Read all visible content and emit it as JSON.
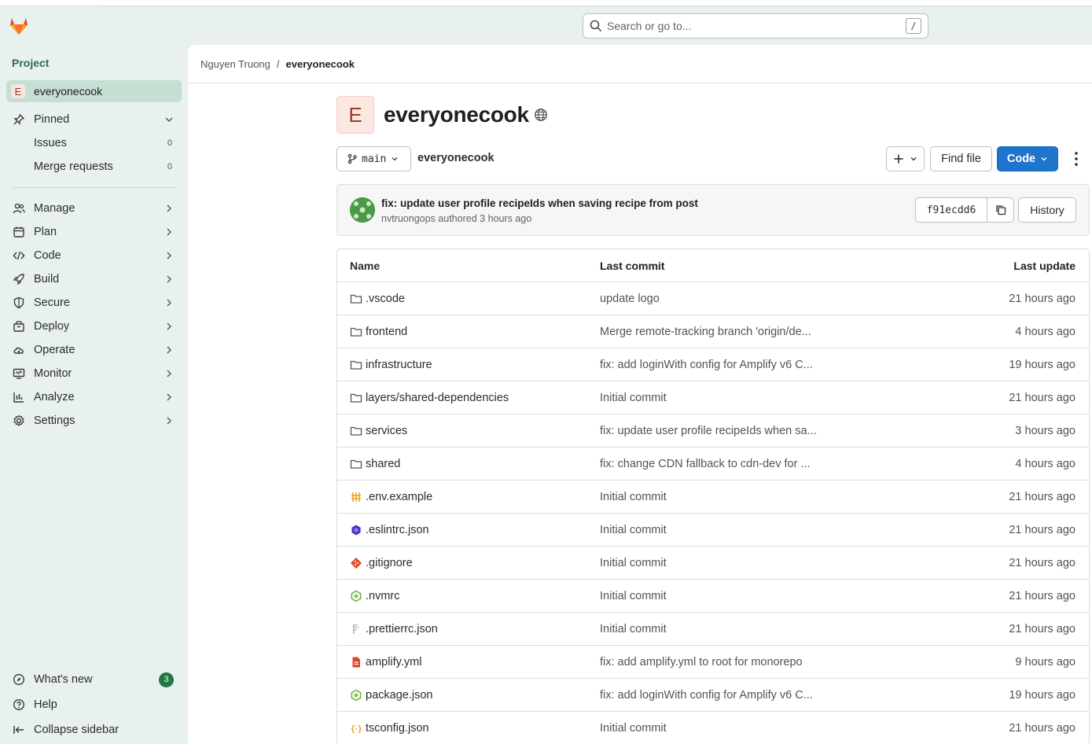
{
  "search": {
    "placeholder": "Search or go to...",
    "shortcut": "/"
  },
  "sidebar": {
    "section_label": "Project",
    "project": {
      "initial": "E",
      "name": "everyonecook"
    },
    "pinned": {
      "label": "Pinned",
      "items": [
        {
          "label": "Issues",
          "count": "0"
        },
        {
          "label": "Merge requests",
          "count": "0"
        }
      ]
    },
    "nav": [
      {
        "label": "Manage",
        "icon": "users-icon"
      },
      {
        "label": "Plan",
        "icon": "calendar-icon"
      },
      {
        "label": "Code",
        "icon": "code-icon"
      },
      {
        "label": "Build",
        "icon": "rocket-icon"
      },
      {
        "label": "Secure",
        "icon": "shield-icon"
      },
      {
        "label": "Deploy",
        "icon": "deploy-icon"
      },
      {
        "label": "Operate",
        "icon": "cloud-gear-icon"
      },
      {
        "label": "Monitor",
        "icon": "monitor-icon"
      },
      {
        "label": "Analyze",
        "icon": "chart-icon"
      },
      {
        "label": "Settings",
        "icon": "gear-icon"
      }
    ],
    "footer": {
      "whats_new": "What's new",
      "whats_new_count": "3",
      "help": "Help",
      "collapse": "Collapse sidebar"
    }
  },
  "breadcrumb": {
    "owner": "Nguyen Truong",
    "separator": "/",
    "project": "everyonecook"
  },
  "project_header": {
    "initial": "E",
    "title": "everyonecook"
  },
  "toolbar": {
    "branch": "main",
    "path": "everyonecook",
    "find_file": "Find file",
    "code": "Code"
  },
  "last_commit": {
    "message": "fix: update user profile recipeIds when saving recipe from post",
    "author": "nvtruongops",
    "authored_text": "authored",
    "time": "3 hours ago",
    "sha": "f91ecdd6",
    "history": "History"
  },
  "files": {
    "headers": {
      "name": "Name",
      "last_commit": "Last commit",
      "last_update": "Last update"
    },
    "rows": [
      {
        "name": ".vscode",
        "type": "folder",
        "commit": "update logo",
        "updated": "21 hours ago"
      },
      {
        "name": "frontend",
        "type": "folder",
        "commit": "Merge remote-tracking branch 'origin/de...",
        "updated": "4 hours ago"
      },
      {
        "name": "infrastructure",
        "type": "folder",
        "commit": "fix: add loginWith config for Amplify v6 C...",
        "updated": "19 hours ago"
      },
      {
        "name": "layers/shared-dependencies",
        "type": "folder",
        "commit": "Initial commit",
        "updated": "21 hours ago"
      },
      {
        "name": "services",
        "type": "folder",
        "commit": "fix: update user profile recipeIds when sa...",
        "updated": "3 hours ago"
      },
      {
        "name": "shared",
        "type": "folder",
        "commit": "fix: change CDN fallback to cdn-dev for ...",
        "updated": "4 hours ago"
      },
      {
        "name": ".env.example",
        "type": "env",
        "commit": "Initial commit",
        "updated": "21 hours ago"
      },
      {
        "name": ".eslintrc.json",
        "type": "eslint",
        "commit": "Initial commit",
        "updated": "21 hours ago"
      },
      {
        "name": ".gitignore",
        "type": "git",
        "commit": "Initial commit",
        "updated": "21 hours ago"
      },
      {
        "name": ".nvmrc",
        "type": "node",
        "commit": "Initial commit",
        "updated": "21 hours ago"
      },
      {
        "name": ".prettierrc.json",
        "type": "prettier",
        "commit": "Initial commit",
        "updated": "21 hours ago"
      },
      {
        "name": "amplify.yml",
        "type": "yaml",
        "commit": "fix: add amplify.yml to root for monorepo",
        "updated": "9 hours ago"
      },
      {
        "name": "package.json",
        "type": "node",
        "commit": "fix: add loginWith config for Amplify v6 C...",
        "updated": "19 hours ago"
      },
      {
        "name": "tsconfig.json",
        "type": "json",
        "commit": "Initial commit",
        "updated": "21 hours ago"
      }
    ]
  }
}
